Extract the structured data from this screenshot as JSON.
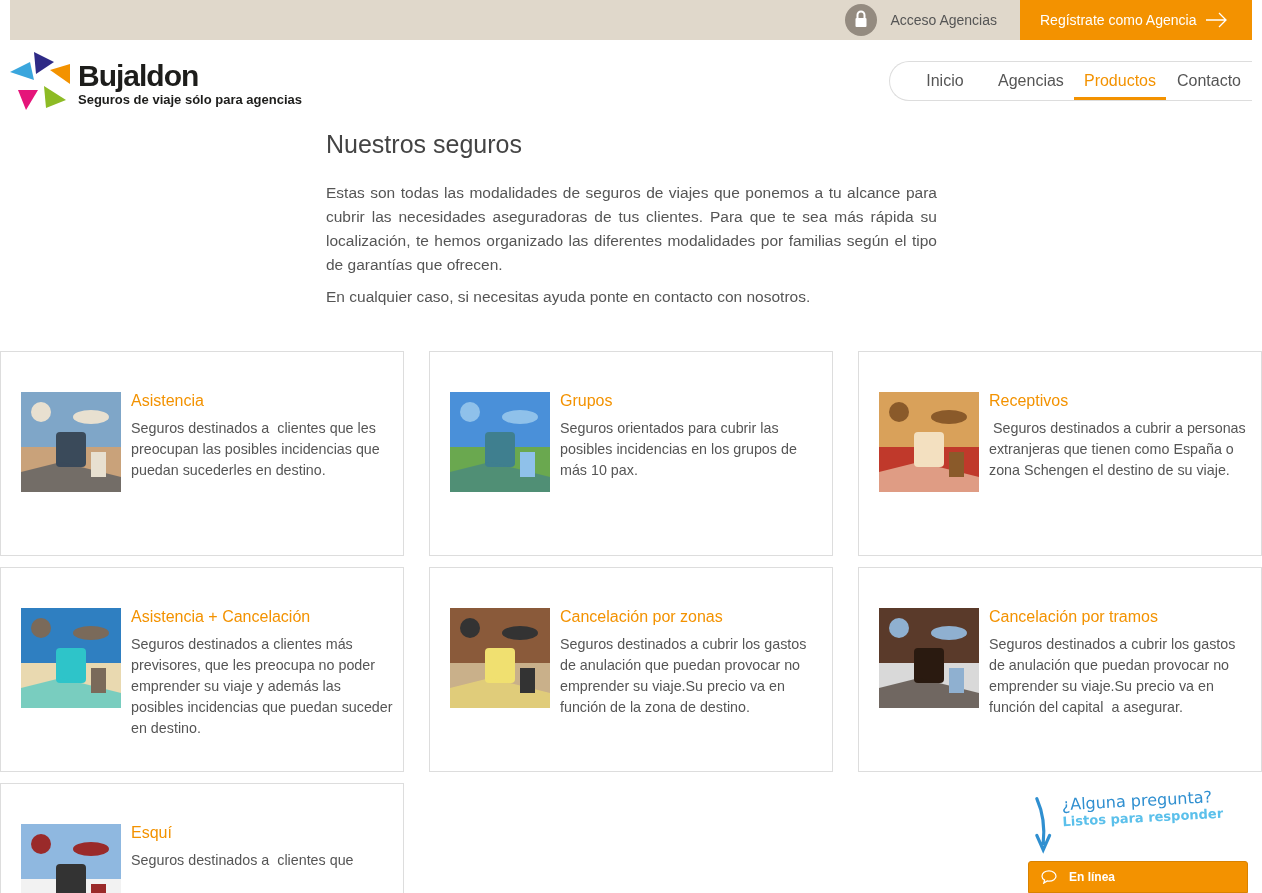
{
  "top_bar": {
    "login_link": "Acceso Agencias",
    "register_button": "Regístrate como Agencia"
  },
  "logo": {
    "name": "Bujaldon",
    "tagline": "Seguros de viaje sólo para agencias"
  },
  "nav": [
    {
      "label": "Inicio",
      "selected": false
    },
    {
      "label": "Agencias",
      "selected": false
    },
    {
      "label": "Productos",
      "selected": true
    },
    {
      "label": "Contacto",
      "selected": false
    }
  ],
  "intro": {
    "title": "Nuestros seguros",
    "paragraphs": [
      "Estas son todas las modalidades de seguros de viajes que ponemos a tu alcance para cubrir las necesidades aseguradoras de tus clientes. Para que te sea más rápida su localización, te hemos organizado las diferentes modalidades por familias según el tipo de garantías que ofrecen.",
      "En cualquier caso, si necesitas ayuda ponte en contacto con nosotros."
    ]
  },
  "products": [
    {
      "title": "Asistencia",
      "text": "Seguros destinados a  clientes que les preocupan las posibles incidencias que puedan sucederles en destino."
    },
    {
      "title": "Grupos",
      "text": "Seguros orientados para cubrir las posibles incidencias en los grupos de más 10 pax."
    },
    {
      "title": "Receptivos",
      "text": " Seguros destinados a cubrir a personas extranjeras que tienen como España o zona Schengen el destino de su viaje."
    },
    {
      "title": "Asistencia + Cancelación",
      "text": "Seguros destinados a clientes más previsores, que les preocupa no poder emprender su viaje y además las posibles incidencias que puedan suceder en destino."
    },
    {
      "title": "Cancelación por zonas",
      "text": "Seguros destinados a cubrir los gastos de anulación que puedan provocar no emprender su viaje.Su precio va en función de la zona de destino."
    },
    {
      "title": "Cancelación por tramos",
      "text": "Seguros destinados a cubrir los gastos de anulación que puedan provocar no emprender su viaje.Su precio va en función del capital  a asegurar."
    },
    {
      "title": "Esquí",
      "text": "Seguros destinados a  clientes que"
    }
  ],
  "chat": {
    "question": "¿Alguna pregunta?",
    "subtitle": "Listos para responder",
    "status": "En línea"
  }
}
